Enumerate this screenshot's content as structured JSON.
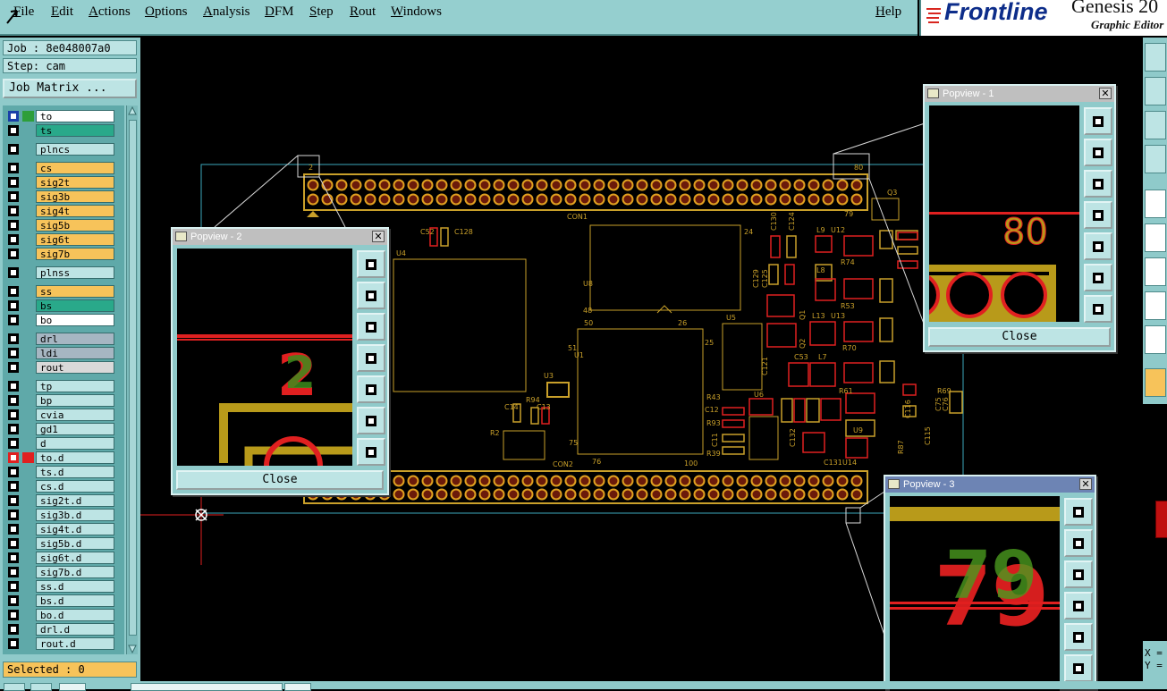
{
  "menu": [
    "File",
    "Edit",
    "Actions",
    "Options",
    "Analysis",
    "DFM",
    "Step",
    "Rout",
    "Windows"
  ],
  "help": "Help",
  "logo": {
    "brand": "Frontline",
    "product": "Genesis 20",
    "subtitle": "Graphic Editor"
  },
  "job": {
    "job_label": "Job : 8e048007a0",
    "step_label": "Step: cam",
    "matrix_button": "Job Matrix ..."
  },
  "layers": [
    {
      "name": "to",
      "color": "#ffffff",
      "ind": "#1a3fa8",
      "ind2": "#2e9e3a"
    },
    {
      "name": "ts",
      "color": "#29a98a"
    },
    {
      "name": "plncs",
      "color": "#bde4e4"
    },
    {
      "name": "cs",
      "color": "#f7c35a"
    },
    {
      "name": "sig2t",
      "color": "#f7c35a"
    },
    {
      "name": "sig3b",
      "color": "#f7c35a"
    },
    {
      "name": "sig4t",
      "color": "#f7c35a"
    },
    {
      "name": "sig5b",
      "color": "#f7c35a"
    },
    {
      "name": "sig6t",
      "color": "#f7c35a"
    },
    {
      "name": "sig7b",
      "color": "#f7c35a"
    },
    {
      "name": "plnss",
      "color": "#bde4e4"
    },
    {
      "name": "ss",
      "color": "#f7c35a"
    },
    {
      "name": "bs",
      "color": "#29a98a"
    },
    {
      "name": "bo",
      "color": "#ffffff"
    },
    {
      "name": "drl",
      "color": "#a6b6c2"
    },
    {
      "name": "ldi",
      "color": "#a6b6c2"
    },
    {
      "name": "rout",
      "color": "#d9d9d9"
    },
    {
      "name": "tp",
      "color": "#bde4e4"
    },
    {
      "name": "bp",
      "color": "#bde4e4"
    },
    {
      "name": "cvia",
      "color": "#bde4e4"
    },
    {
      "name": "gd1",
      "color": "#bde4e4"
    },
    {
      "name": "d",
      "color": "#bde4e4"
    },
    {
      "name": "to.d",
      "color": "#bde4e4",
      "ind": "#e02020"
    },
    {
      "name": "ts.d",
      "color": "#bde4e4"
    },
    {
      "name": "cs.d",
      "color": "#bde4e4"
    },
    {
      "name": "sig2t.d",
      "color": "#bde4e4"
    },
    {
      "name": "sig3b.d",
      "color": "#bde4e4"
    },
    {
      "name": "sig4t.d",
      "color": "#bde4e4"
    },
    {
      "name": "sig5b.d",
      "color": "#bde4e4"
    },
    {
      "name": "sig6t.d",
      "color": "#bde4e4"
    },
    {
      "name": "sig7b.d",
      "color": "#bde4e4"
    },
    {
      "name": "ss.d",
      "color": "#bde4e4"
    },
    {
      "name": "bs.d",
      "color": "#bde4e4"
    },
    {
      "name": "bo.d",
      "color": "#bde4e4"
    },
    {
      "name": "drl.d",
      "color": "#bde4e4"
    },
    {
      "name": "rout.d",
      "color": "#bde4e4"
    }
  ],
  "selected": "Selected : 0",
  "popviews": [
    {
      "title": "Popview - 2",
      "close": "Close",
      "label": "2"
    },
    {
      "title": "Popview - 1",
      "close": "Close",
      "label": "80"
    },
    {
      "title": "Popview - 3",
      "close": "Close",
      "label": "79"
    }
  ],
  "coords": {
    "x": "X =",
    "y": "Y ="
  },
  "pcb_labels": {
    "con1": "CON1",
    "con2": "CON2",
    "u4": "U4",
    "u3": "U3",
    "u1": "U1",
    "u8": "U8",
    "u5": "U5",
    "u6": "U6",
    "c52": "C52",
    "c128": "C128",
    "c14": "C14",
    "c13": "C13",
    "r94": "R94",
    "r2": "R2",
    "n50": "50",
    "n26": "26",
    "n25": "25",
    "n24": "24",
    "n48": "48",
    "n51": "51",
    "n75": "75",
    "n76": "76",
    "n100": "100",
    "n1": "1",
    "n2": "2",
    "n80": "80",
    "n79": "79",
    "l9": "L9",
    "l8": "L8",
    "l13": "L13",
    "l7": "L7",
    "l5": "L5",
    "u12": "U12",
    "u13": "U13",
    "u9": "U9",
    "u14": "U14",
    "r74": "R74",
    "r53": "R53",
    "r70": "R70",
    "r61": "R61",
    "r43": "R43",
    "r93": "R93",
    "r39": "R39",
    "r87": "R87",
    "c130": "C130",
    "c124": "C124",
    "c129": "C129",
    "c125": "C125",
    "c53": "C53",
    "c12": "C12",
    "c11": "C11",
    "c132": "C132",
    "c131": "C131",
    "c121": "C121",
    "c116": "C116",
    "c115": "C115",
    "q1": "Q1",
    "q2": "Q2",
    "q3": "Q3",
    "r69": "R69",
    "c75": "C75",
    "c76": "C76"
  }
}
